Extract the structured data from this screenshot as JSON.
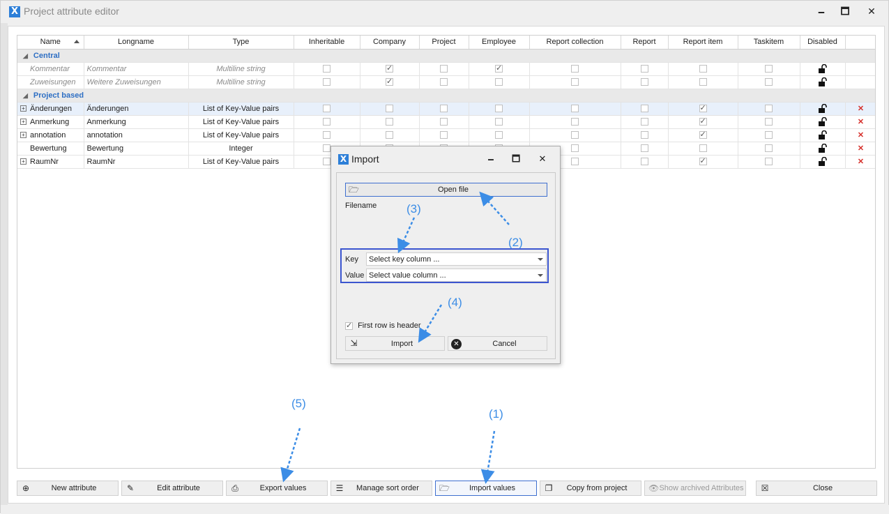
{
  "window": {
    "title": "Project attribute editor",
    "icon": "X",
    "controls": {
      "minimize": "🗕",
      "maximize": "🗖",
      "close": "✕"
    }
  },
  "grid": {
    "columns": [
      "Name",
      "Longname",
      "Type",
      "Inheritable",
      "Company",
      "Project",
      "Employee",
      "Report collection",
      "Report",
      "Report item",
      "Taskitem",
      "Disabled",
      ""
    ],
    "groups": [
      {
        "label": "Central",
        "rows": [
          {
            "name": "Kommentar",
            "longname": "Kommentar",
            "type": "Multiline string",
            "checks": [
              false,
              true,
              false,
              true,
              false,
              false,
              false,
              false
            ],
            "expandable": false,
            "deletable": false
          },
          {
            "name": "Zuweisungen",
            "longname": "Weitere Zuweisungen",
            "type": "Multiline string",
            "checks": [
              false,
              true,
              false,
              false,
              false,
              false,
              false,
              false
            ],
            "expandable": false,
            "deletable": false
          }
        ]
      },
      {
        "label": "Project based",
        "rows": [
          {
            "name": "Änderungen",
            "longname": "Änderungen",
            "type": "List of Key-Value pairs",
            "checks": [
              false,
              false,
              false,
              false,
              false,
              false,
              true,
              false
            ],
            "expandable": true,
            "deletable": true
          },
          {
            "name": "Anmerkung",
            "longname": "Anmerkung",
            "type": "List of Key-Value pairs",
            "checks": [
              false,
              false,
              false,
              false,
              false,
              false,
              true,
              false
            ],
            "expandable": true,
            "deletable": true
          },
          {
            "name": "annotation",
            "longname": "annotation",
            "type": "List of Key-Value pairs",
            "checks": [
              false,
              false,
              false,
              false,
              false,
              false,
              true,
              false
            ],
            "expandable": true,
            "deletable": true
          },
          {
            "name": "Bewertung",
            "longname": "Bewertung",
            "type": "Integer",
            "checks": [
              false,
              false,
              false,
              false,
              false,
              false,
              false,
              false
            ],
            "expandable": false,
            "deletable": true
          },
          {
            "name": "RaumNr",
            "longname": "RaumNr",
            "type": "List of Key-Value pairs",
            "checks": [
              false,
              false,
              false,
              false,
              false,
              false,
              true,
              false
            ],
            "expandable": true,
            "deletable": true
          }
        ]
      }
    ]
  },
  "toolbar": {
    "new_attribute": "New attribute",
    "edit_attribute": "Edit attribute",
    "export_values": "Export values",
    "manage_sort_order": "Manage sort order",
    "import_values": "Import values",
    "copy_from_project": "Copy from project",
    "show_archived": "Show archived Attributes",
    "close": "Close"
  },
  "dialog": {
    "title": "Import",
    "open_file": "Open file",
    "filename_label": "Filename",
    "key_label": "Key",
    "key_value": "Select key column ...",
    "value_label": "Value",
    "value_value": "Select value column ...",
    "first_row_header": "First row is header",
    "first_row_checked": true,
    "import": "Import",
    "cancel": "Cancel"
  },
  "annotations": {
    "a1": "(1)",
    "a2": "(2)",
    "a3": "(3)",
    "a4": "(4)",
    "a5": "(5)"
  },
  "colors": {
    "accent": "#3e6fcf",
    "group_label": "#2e6fc4",
    "annotation": "#3c8de6",
    "delete": "#d6302b"
  }
}
